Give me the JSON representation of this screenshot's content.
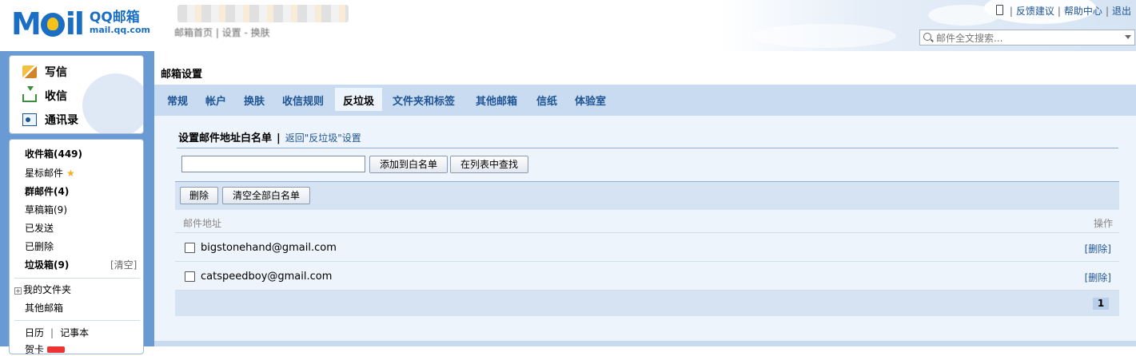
{
  "header": {
    "logo_text": "M  il",
    "brand_name": "QQ邮箱",
    "brand_domain": "mail.qq.com",
    "breadcrumb": "邮箱首页 | 设置 - 换肤",
    "top_links": {
      "feedback": "反馈建议",
      "help": "帮助中心",
      "logout": "退出"
    },
    "search_placeholder": "邮件全文搜索..."
  },
  "commands": {
    "compose": "写信",
    "receive": "收信",
    "contacts": "通讯录"
  },
  "folders": {
    "inbox": "收件箱(449)",
    "starred": "星标邮件",
    "group": "群邮件(4)",
    "drafts": "草稿箱(9)",
    "sent": "已发送",
    "deleted": "已删除",
    "junk": "垃圾箱(9)",
    "junk_clear": "[清空]",
    "my_folders": "我的文件夹",
    "other_mailbox": "其他邮箱",
    "calendar": "日历",
    "notebook": "记事本",
    "more": "贺卡"
  },
  "main": {
    "title": "邮箱设置",
    "tabs": [
      "常规",
      "帐户",
      "换肤",
      "收信规则",
      "反垃圾",
      "文件夹和标签",
      "其他邮箱",
      "信纸",
      "体验室"
    ],
    "active_tab": "反垃圾",
    "section_title": "设置邮件地址白名单",
    "back_link": "返回\"反垃圾\"设置",
    "add_button": "添加到白名单",
    "find_button": "在列表中查找",
    "delete_button": "删除",
    "clear_button": "清空全部白名单",
    "col_email": "邮件地址",
    "col_action": "操作",
    "rows": [
      {
        "email": "bigstonehand@gmail.com",
        "action": "[删除]"
      },
      {
        "email": "catspeedboy@gmail.com",
        "action": "[删除]"
      }
    ],
    "page": "1"
  },
  "colors": {
    "accent": "#1a6fc4",
    "link": "#1e5494",
    "sidebar_bg": "#6a9ad3",
    "tab_bar": "#c9dbf1",
    "panel_bg": "#eef4fb"
  }
}
